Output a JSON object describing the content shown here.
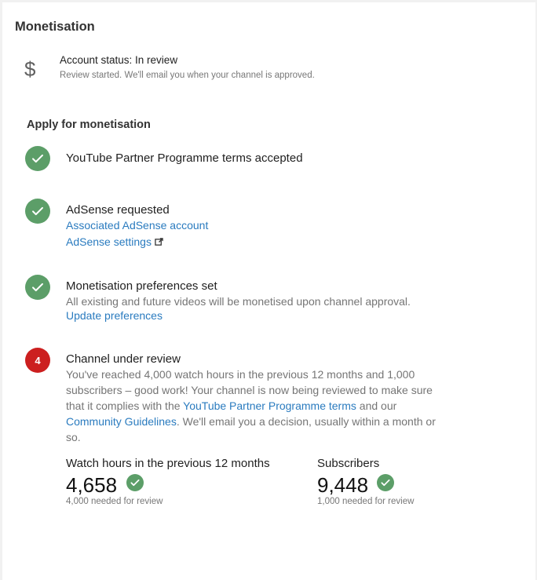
{
  "header": {
    "title": "Monetisation"
  },
  "account": {
    "icon": "dollar-icon",
    "status_label": "Account status: In review",
    "status_detail": "Review started. We'll email you when your channel is approved."
  },
  "apply": {
    "title": "Apply for monetisation",
    "steps": [
      {
        "title": "YouTube Partner Programme terms accepted",
        "state": "done"
      },
      {
        "title": "AdSense requested",
        "state": "done",
        "links": [
          "Associated AdSense account",
          "AdSense settings"
        ]
      },
      {
        "title": "Monetisation preferences set",
        "state": "done",
        "description": "All existing and future videos will be monetised upon channel approval.",
        "links": [
          "Update preferences"
        ]
      },
      {
        "title": "Channel under review",
        "state": "pending",
        "number": "4",
        "description_parts": {
          "p1": "You've reached 4,000 watch hours in the previous 12 months and 1,000 subscribers – good work! Your channel is now being reviewed to make sure that it complies with the ",
          "link1": "YouTube Partner Programme terms",
          "p2": " and our ",
          "link2": "Community Guidelines",
          "p3": ". We'll email you a decision, usually within a month or so."
        }
      }
    ]
  },
  "metrics": {
    "watch_hours": {
      "label": "Watch hours in the previous 12 months",
      "value": "4,658",
      "requirement": "4,000 needed for review"
    },
    "subscribers": {
      "label": "Subscribers",
      "value": "9,448",
      "requirement": "1,000 needed for review"
    }
  },
  "colors": {
    "accent_link": "#2a7bbf",
    "done_green": "#5c9e68",
    "pending_red": "#cc1f1f"
  }
}
